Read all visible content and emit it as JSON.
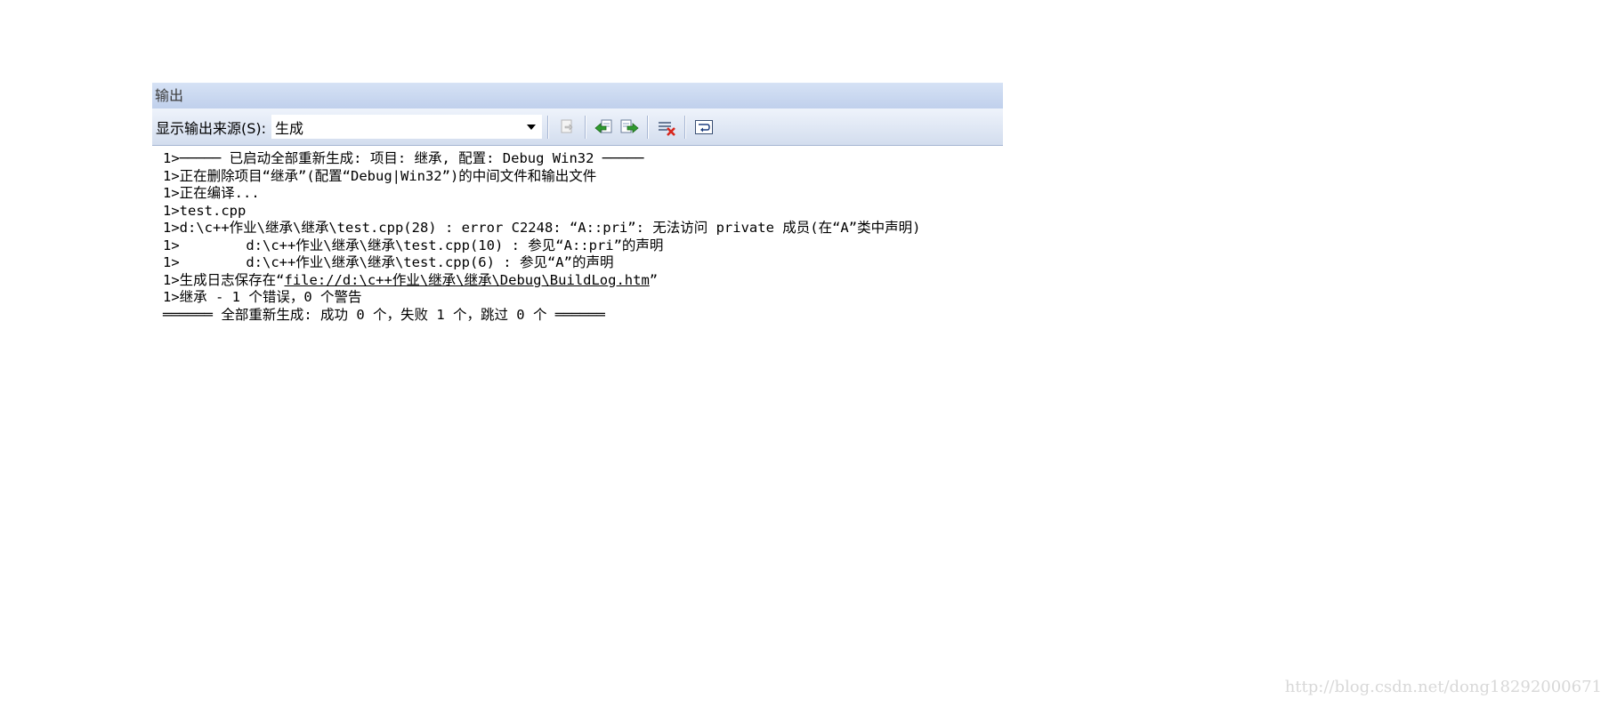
{
  "window": {
    "title": "输出"
  },
  "toolbar": {
    "source_label": "显示输出来源(S):",
    "source_value": "生成",
    "buttons": [
      {
        "icon": "go-to-line-icon",
        "enabled": false
      },
      {
        "icon": "previous-message-icon",
        "enabled": true
      },
      {
        "icon": "next-message-icon",
        "enabled": true
      },
      {
        "icon": "clear-all-icon",
        "enabled": true
      },
      {
        "icon": "word-wrap-toggle-icon",
        "enabled": true
      }
    ]
  },
  "output": {
    "lines": [
      "1>───── 已启动全部重新生成: 项目: 继承, 配置: Debug Win32 ─────",
      "1>正在删除项目“继承”(配置“Debug|Win32”)的中间文件和输出文件",
      "1>正在编译...",
      "1>test.cpp",
      "1>d:\\c++作业\\继承\\继承\\test.cpp(28) : error C2248: “A::pri”: 无法访问 private 成员(在“A”类中声明)",
      "1>        d:\\c++作业\\继承\\继承\\test.cpp(10) : 参见“A::pri”的声明",
      "1>        d:\\c++作业\\继承\\继承\\test.cpp(6) : 参见“A”的声明"
    ],
    "buildlog_prefix": "1>生成日志保存在“",
    "buildlog_link": "file://d:\\c++作业\\继承\\继承\\Debug\\BuildLog.htm",
    "buildlog_suffix": "”",
    "summary_line": "1>继承 - 1 个错误，0 个警告",
    "final_line": "══════ 全部重新生成: 成功 0 个，失败 1 个，跳过 0 个 ══════"
  },
  "watermark": "http://blog.csdn.net/dong18292000671",
  "colors": {
    "title_gradient_top": "#d6e2f5",
    "title_gradient_bottom": "#c0d0ec",
    "toolbar_border": "#a6b6d3"
  }
}
